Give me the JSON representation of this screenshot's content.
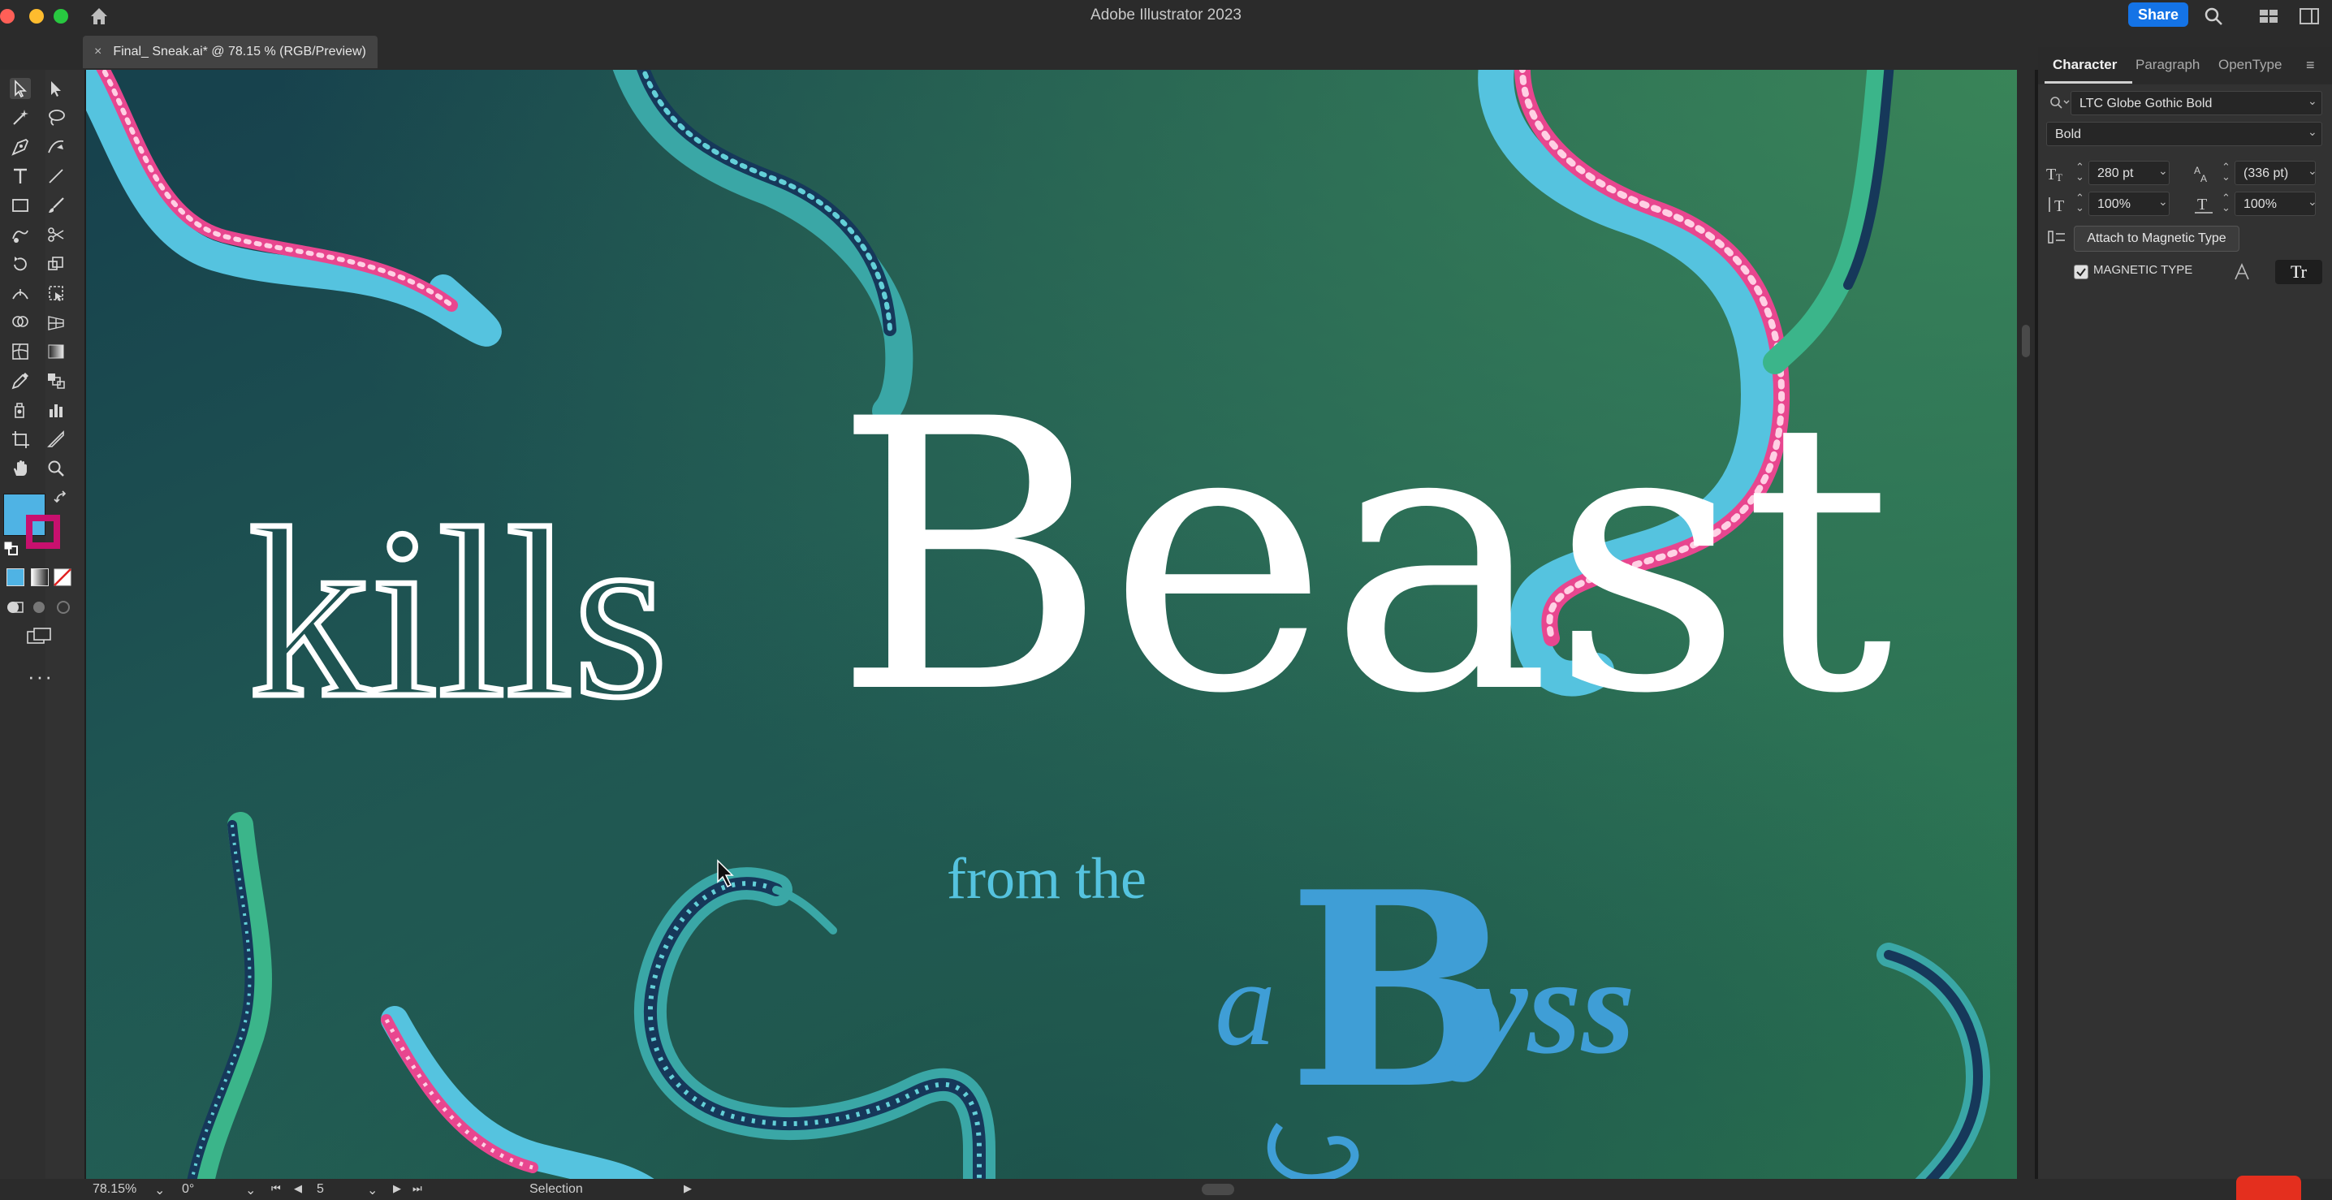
{
  "app": {
    "title": "Adobe Illustrator 2023",
    "share_label": "Share"
  },
  "document": {
    "tab_title": "Final_ Sneak.ai* @ 78.15 % (RGB/Preview)",
    "close_glyph": "×"
  },
  "artwork": {
    "word_kills": "kills",
    "word_beast": "Beast",
    "word_from_the": "from the",
    "word_abyss_a": "a",
    "word_abyss_b": "B",
    "word_abyss_yss": "yss",
    "colors": {
      "bg_top": "#19474e",
      "bg_bottom": "#2e7a52",
      "pink": "#e8468f",
      "cyan": "#55c3df",
      "navy": "#16385a",
      "teal": "#3bb58a",
      "abyss_blue": "#3f9ed6",
      "title_white": "#ffffff"
    }
  },
  "panel": {
    "tabs": [
      "Character",
      "Paragraph",
      "OpenType"
    ],
    "font_family": "LTC Globe Gothic Bold",
    "font_style": "Bold",
    "font_size": "280 pt",
    "leading": "(336 pt)",
    "vertical_scale": "100%",
    "horizontal_scale": "100%",
    "attach_button": "Attach to Magnetic Type",
    "magnetic_label": "MAGNETIC TYPE",
    "magnetic_checked": true,
    "tt_label": "Tr"
  },
  "status": {
    "zoom": "78.15%",
    "rotation": "0°",
    "artboard": "5",
    "tool": "Selection"
  },
  "fill_color": "#4fb3e4",
  "stroke_color": "#c8106e"
}
